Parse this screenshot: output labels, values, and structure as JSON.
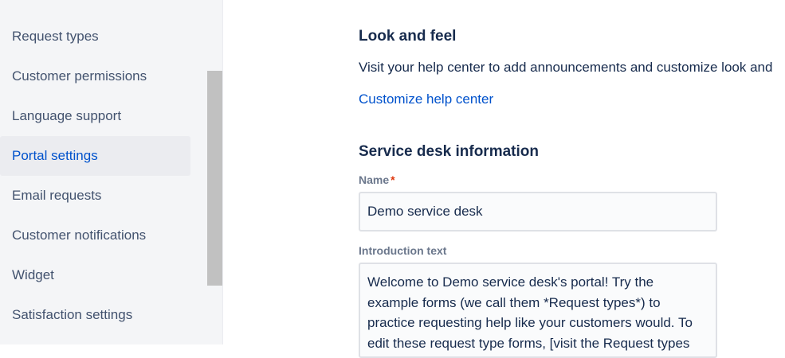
{
  "sidebar": {
    "items": [
      {
        "label": "Request types"
      },
      {
        "label": "Customer permissions"
      },
      {
        "label": "Language support"
      },
      {
        "label": "Portal settings",
        "active": true
      },
      {
        "label": "Email requests"
      },
      {
        "label": "Customer notifications"
      },
      {
        "label": "Widget"
      },
      {
        "label": "Satisfaction settings"
      }
    ]
  },
  "look_and_feel": {
    "title": "Look and feel",
    "description": "Visit your help center to add announcements and customize look and",
    "link_label": "Customize help center"
  },
  "service_desk_info": {
    "title": "Service desk information",
    "name_label": "Name",
    "required_marker": "*",
    "name_value": "Demo service desk",
    "intro_label": "Introduction text",
    "intro_value": "Welcome to Demo service desk's portal! Try the example forms (we call them *Request types*) to practice requesting help like your customers would. To edit these request type forms, [visit the Request types"
  },
  "colors": {
    "accent": "#0052cc",
    "sidebar_bg": "#f4f5f7",
    "active_item_bg": "#ebecf0",
    "required": "#de350b"
  }
}
